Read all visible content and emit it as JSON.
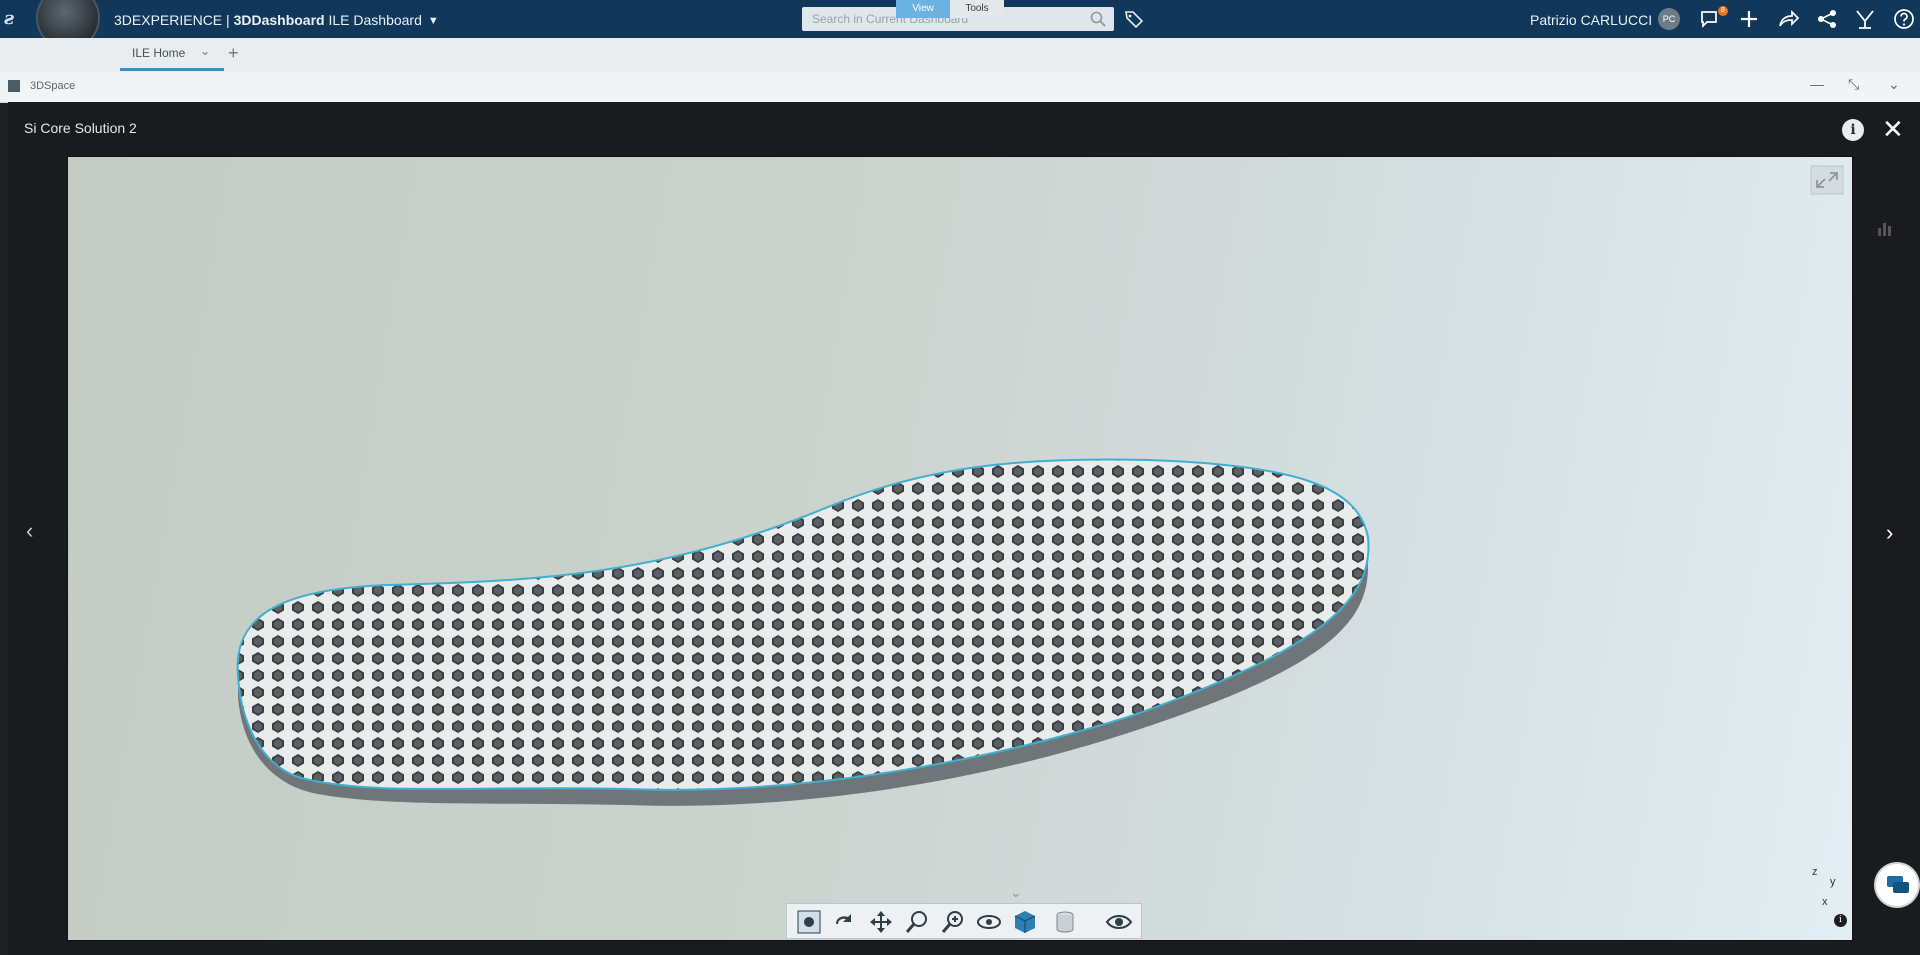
{
  "topbar": {
    "brand_prefix": "3DEXPERIENCE | ",
    "brand_app": "3DDashboard",
    "brand_dashboard": " ILE Dashboard",
    "search_placeholder": "Search in Current Dashboard",
    "user_name": "Patrizio CARLUCCI",
    "avatar_initials": "PC",
    "notification_count": "8"
  },
  "tabs": {
    "active_label": "ILE Home"
  },
  "widget": {
    "title": "3DSpace"
  },
  "viewer": {
    "title": "Si Core Solution 2",
    "toolbar_tabs": [
      "View",
      "Tools"
    ],
    "axes": {
      "z": "z",
      "y": "y",
      "x": "x"
    }
  },
  "colors": {
    "topbar": "#11385a",
    "accent": "#368ec4",
    "model_outline": "#3fb0d0",
    "active_tab": "#6cb2e0"
  },
  "icons": [
    "compass-icon",
    "search-icon",
    "tag-icon",
    "notification-icon",
    "plus-icon",
    "share-icon",
    "network-icon",
    "tools-icon",
    "help-icon",
    "info-icon",
    "close-icon",
    "expand-icon",
    "fit-all-icon",
    "rotate-icon",
    "pan-icon",
    "zoom-area-icon",
    "zoom-icon",
    "look-at-icon",
    "cube-icon",
    "cylinder-icon",
    "visibility-icon",
    "chat-icon"
  ]
}
